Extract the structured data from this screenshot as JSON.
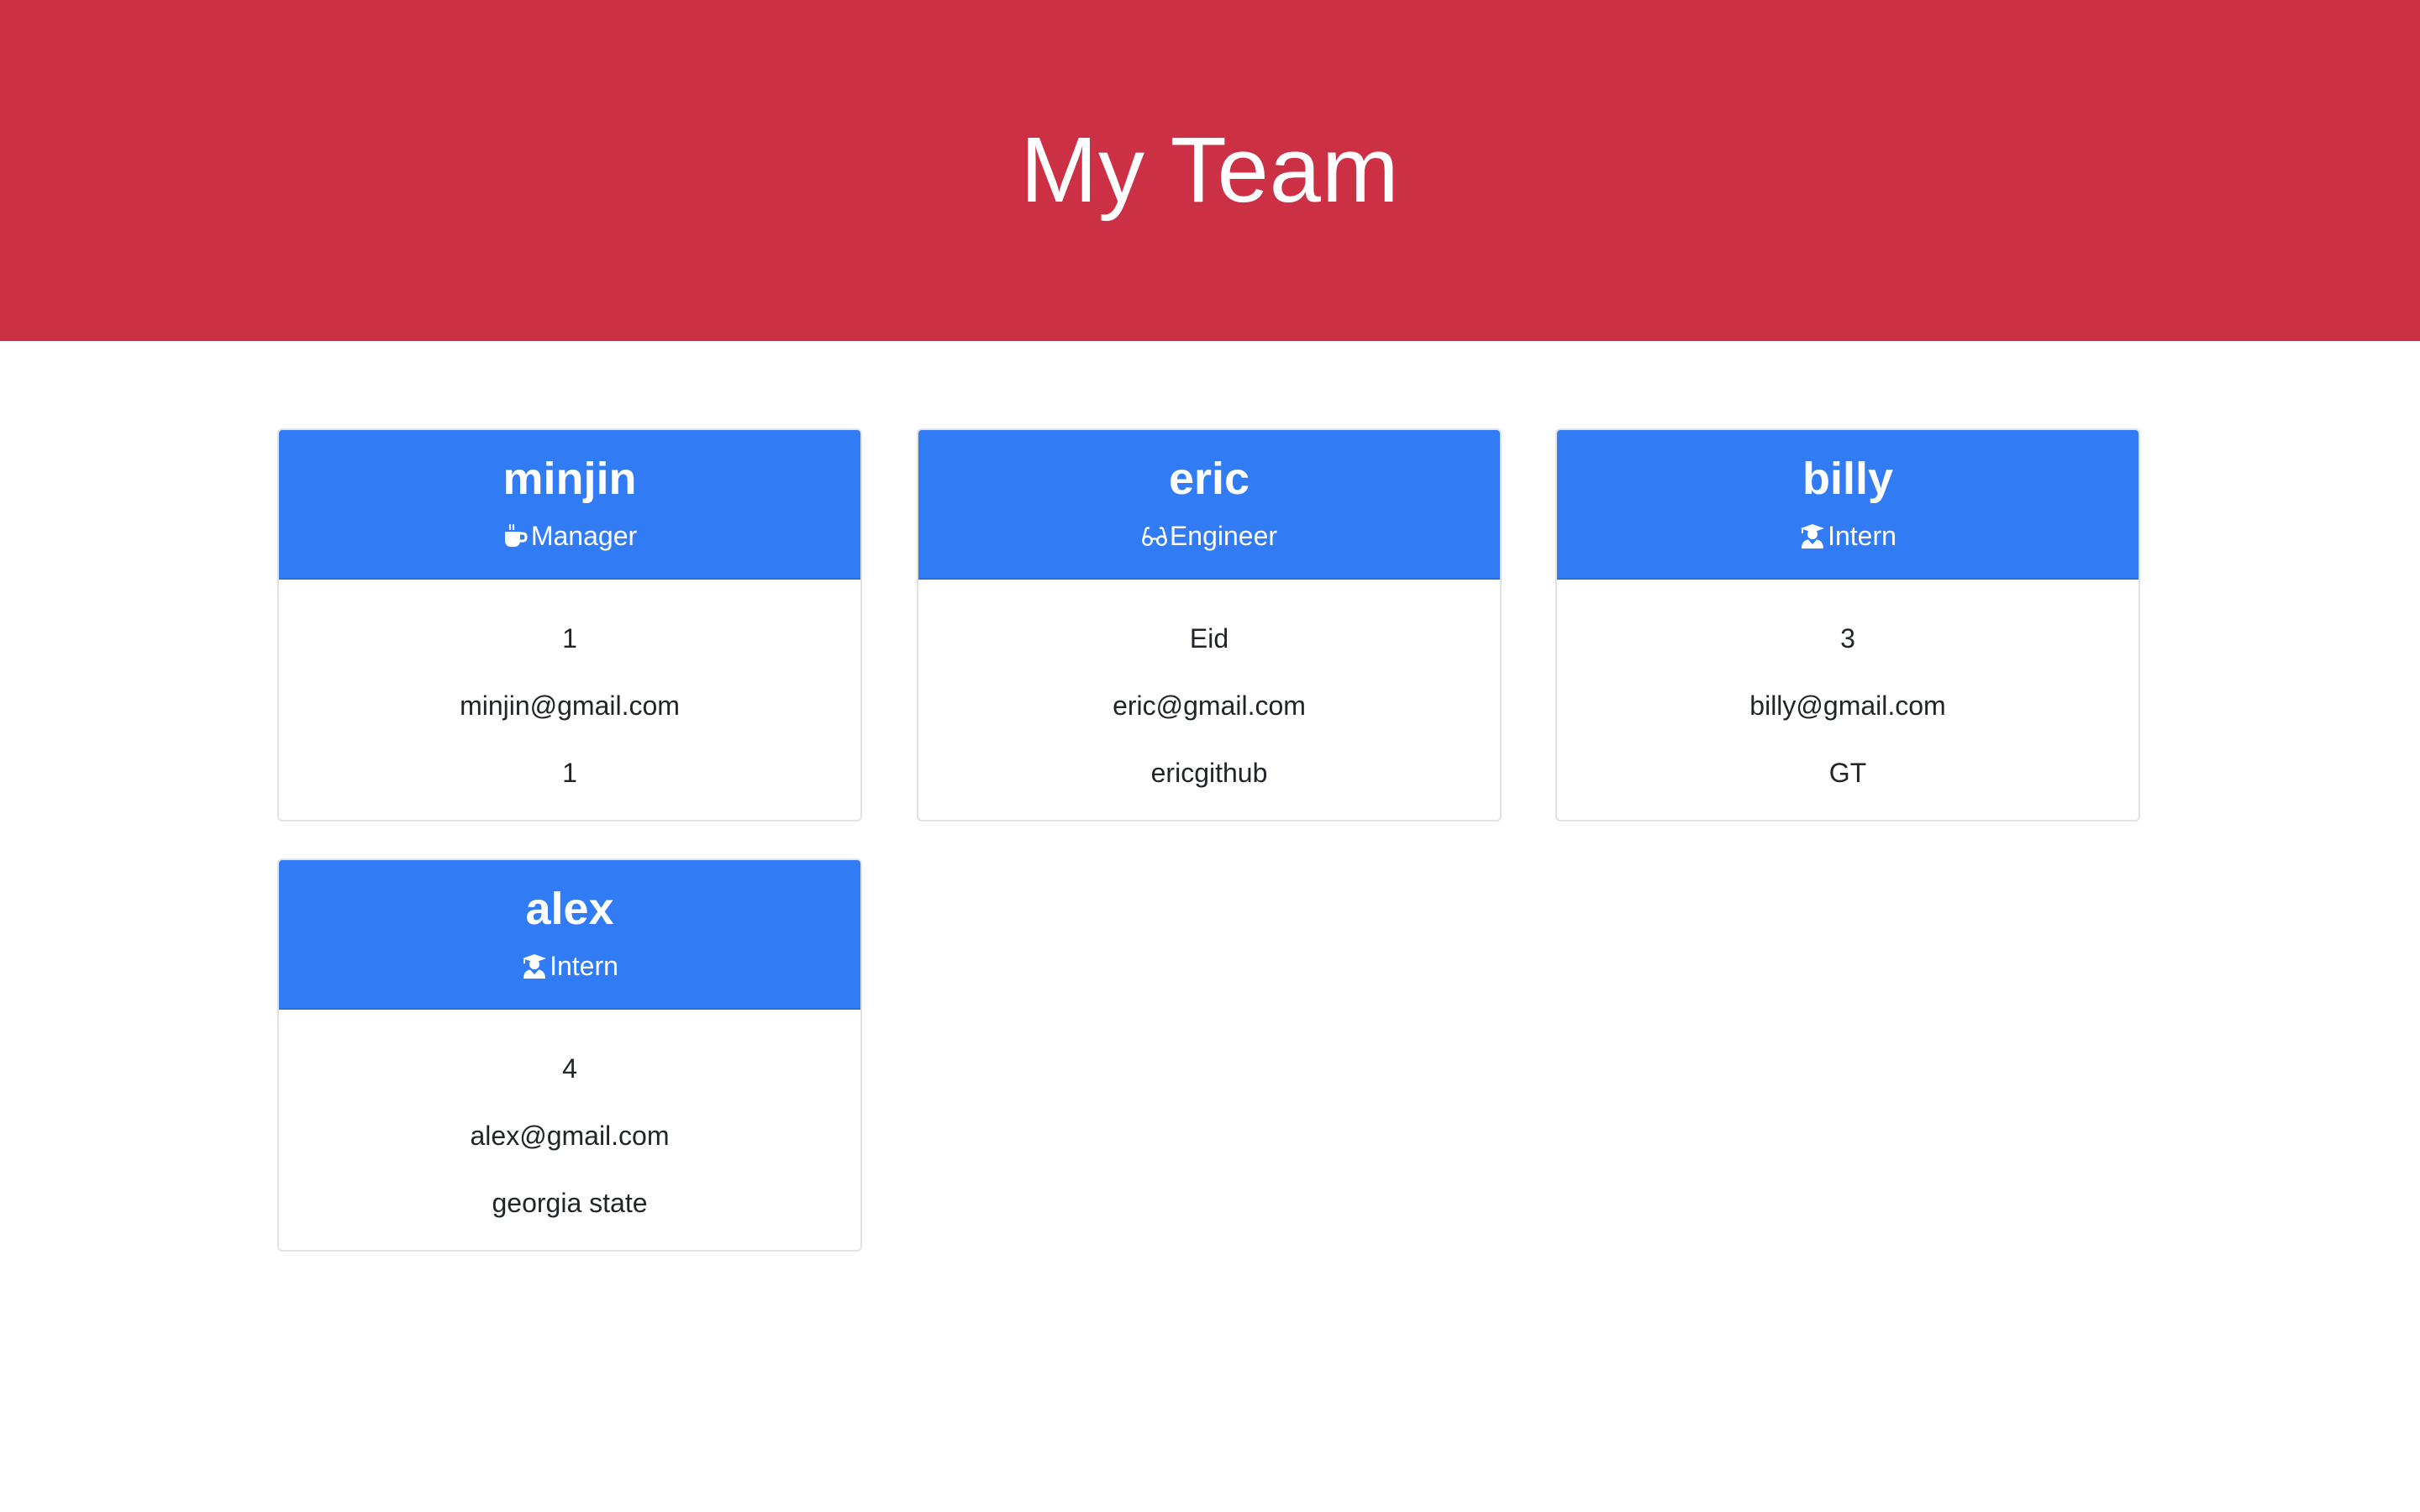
{
  "page": {
    "title": "My Team"
  },
  "colors": {
    "header_bg": "#cc3044",
    "card_header_bg": "#317cf5",
    "text": "#212529"
  },
  "team": [
    {
      "name": "minjin",
      "role": "Manager",
      "role_icon": "coffee-icon",
      "id": "1",
      "email": "minjin@gmail.com",
      "extra": "1"
    },
    {
      "name": "eric",
      "role": "Engineer",
      "role_icon": "glasses-icon",
      "id": "Eid",
      "email": "eric@gmail.com",
      "extra": "ericgithub"
    },
    {
      "name": "billy",
      "role": "Intern",
      "role_icon": "graduate-icon",
      "id": "3",
      "email": "billy@gmail.com",
      "extra": "GT"
    },
    {
      "name": "alex",
      "role": "Intern",
      "role_icon": "graduate-icon",
      "id": "4",
      "email": "alex@gmail.com",
      "extra": "georgia state"
    }
  ]
}
